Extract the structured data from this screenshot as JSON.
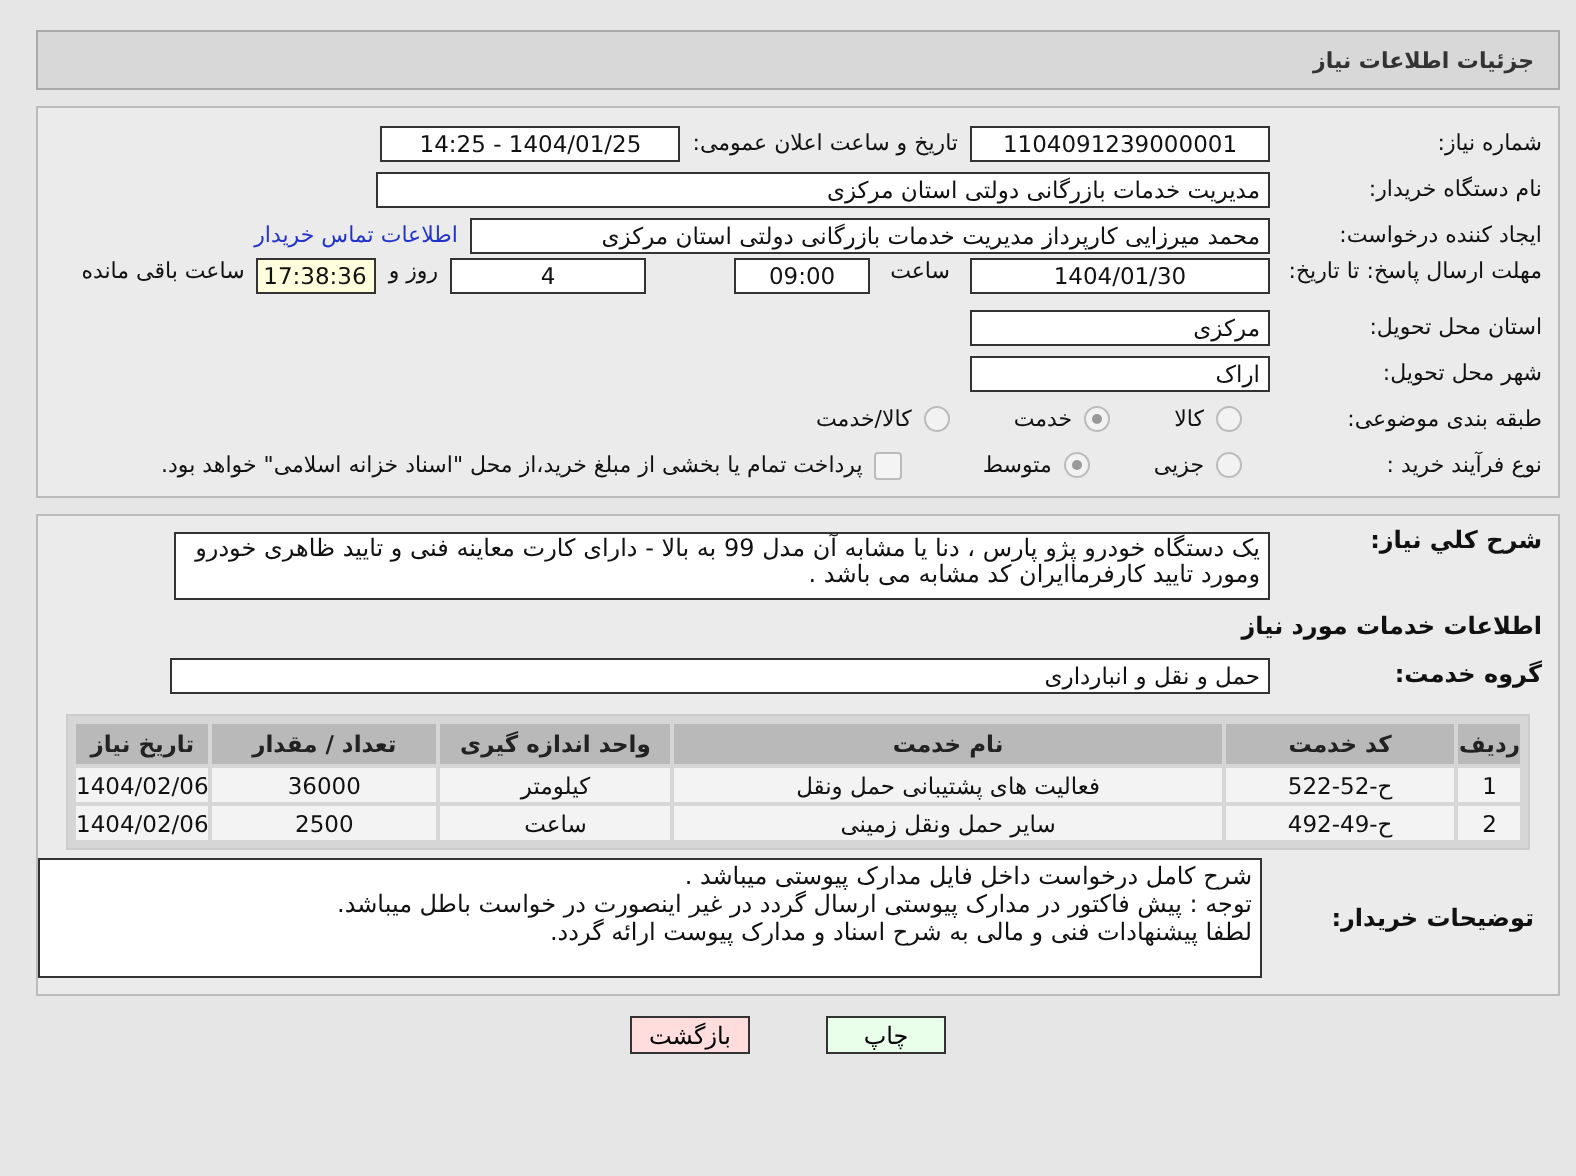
{
  "header": {
    "title": "جزئیات اطلاعات نیاز"
  },
  "need_number": {
    "label": "شماره نیاز:",
    "value": "1104091239000001"
  },
  "announce": {
    "label": "تاریخ و ساعت اعلان عمومی:",
    "value": "1404/01/25 - 14:25"
  },
  "buyer_org": {
    "label": "نام دستگاه خریدار:",
    "value": "مدیریت خدمات بازرگانی دولتی استان مرکزی"
  },
  "requester": {
    "label": "ایجاد کننده درخواست:",
    "value": "محمد میرزایی کارپرداز مدیریت خدمات بازرگانی دولتی استان مرکزی",
    "link": "اطلاعات تماس خریدار"
  },
  "deadline": {
    "label": "مهلت ارسال پاسخ: تا تاریخ:",
    "date": "1404/01/30",
    "time_label": "ساعت",
    "time": "09:00",
    "days": "4",
    "days_label": "روز و",
    "remaining": "17:38:36",
    "remaining_label": "ساعت باقی مانده"
  },
  "province": {
    "label": "استان محل تحویل:",
    "value": "مرکزی"
  },
  "city": {
    "label": "شهر محل تحویل:",
    "value": "اراک"
  },
  "category": {
    "label": "طبقه بندی موضوعی:",
    "options": [
      {
        "label": "کالا",
        "selected": false
      },
      {
        "label": "خدمت",
        "selected": true
      },
      {
        "label": "کالا/خدمت",
        "selected": false
      }
    ]
  },
  "process": {
    "label": "نوع فرآیند خرید :",
    "options": [
      {
        "label": "جزیی",
        "selected": false
      },
      {
        "label": "متوسط",
        "selected": true
      }
    ],
    "payment": {
      "label": "پرداخت تمام یا بخشی از مبلغ خرید،از محل \"اسناد خزانه اسلامی\" خواهد بود.",
      "checked": false
    }
  },
  "summary": {
    "label": "شرح كلي نياز:",
    "value": "یک دستگاه خودرو  پژو پارس ، دنا یا مشابه آن مدل 99 به بالا - دارای کارت معاینه فنی و تایید ظاهری خودرو ومورد تایید کارفرماایران کد مشابه می باشد ."
  },
  "services_title": "اطلاعات خدمات مورد نیاز",
  "service_group": {
    "label": "گروه خدمت:",
    "value": "حمل و نقل و انبارداری"
  },
  "table": {
    "columns": [
      "ردیف",
      "کد خدمت",
      "نام خدمت",
      "واحد اندازه گیری",
      "تعداد / مقدار",
      "تاریخ نیاز"
    ],
    "rows": [
      [
        "1",
        "ح-52-522",
        "فعالیت های پشتیبانی حمل ونقل",
        "کیلومتر",
        "36000",
        "1404/02/06"
      ],
      [
        "2",
        "ح-49-492",
        "سایر حمل ونقل زمینی",
        "ساعت",
        "2500",
        "1404/02/06"
      ]
    ]
  },
  "buyer_notes": {
    "label": "توضیحات خریدار:",
    "value": "شرح کامل درخواست داخل فایل مدارک پیوستی میباشد .\n توجه : پیش فاکتور در مدارک پیوستی ارسال گردد در غیر اینصورت در خواست باطل میباشد.\nلطفا پیشنهادات فنی و مالی به شرح اسناد و مدارک پیوست ارائه گردد."
  },
  "buttons": [
    {
      "label": "چاپ",
      "kind": "print"
    },
    {
      "label": "بازگشت",
      "kind": "back"
    }
  ]
}
